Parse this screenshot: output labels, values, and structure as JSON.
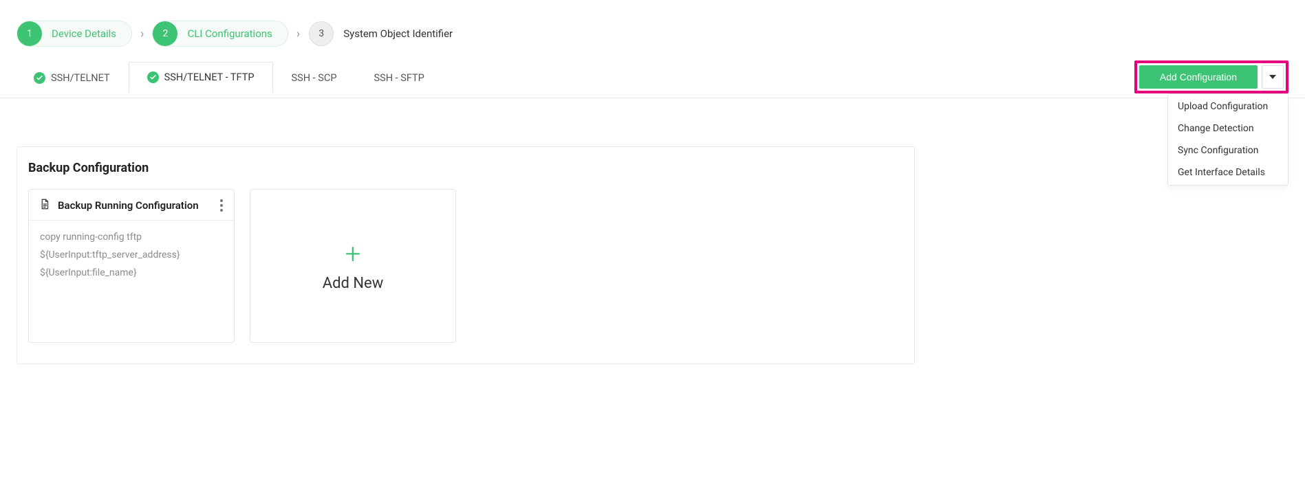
{
  "wizard": {
    "steps": [
      {
        "num": "1",
        "label": "Device Details"
      },
      {
        "num": "2",
        "label": "CLI Configurations"
      },
      {
        "num": "3",
        "label": "System Object Identifier"
      }
    ]
  },
  "tabs": [
    {
      "label": "SSH/TELNET",
      "checked": true
    },
    {
      "label": "SSH/TELNET - TFTP",
      "checked": true,
      "active": true
    },
    {
      "label": "SSH - SCP"
    },
    {
      "label": "SSH - SFTP"
    }
  ],
  "action": {
    "add_label": "Add Configuration",
    "menu": [
      "Upload Configuration",
      "Change Detection",
      "Sync Configuration",
      "Get Interface Details"
    ]
  },
  "panel": {
    "title": "Backup Configuration",
    "card": {
      "title": "Backup Running Configuration",
      "line1": "copy running-config tftp",
      "line2": "${UserInput:tftp_server_address}",
      "line3": "${UserInput:file_name}"
    },
    "addnew_label": "Add New"
  }
}
